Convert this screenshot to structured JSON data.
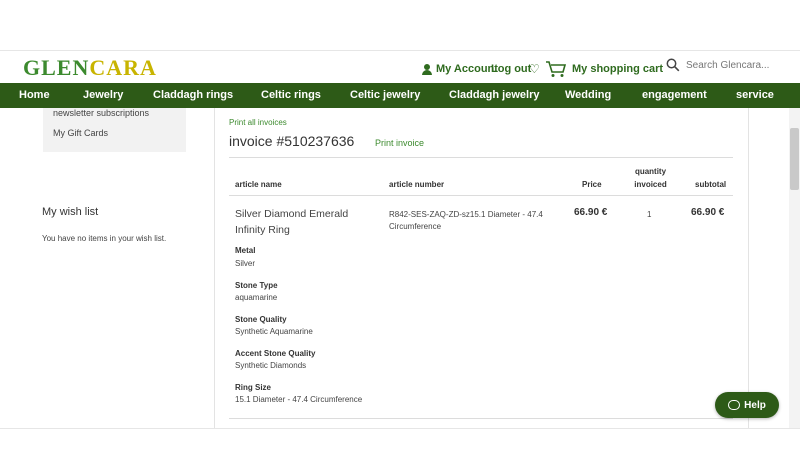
{
  "brand": {
    "logo_part1": "GLEN",
    "logo_part2": "CARA",
    "colors": {
      "green": "#2d5a17",
      "gold": "#c8b400",
      "link_green": "#3c8a2e"
    }
  },
  "header": {
    "account_label": "My Account",
    "logout_label": "Log out",
    "cart_label": "My shopping cart",
    "search_placeholder": "Search Glencara..."
  },
  "nav": {
    "items": [
      "Home",
      "Jewelry",
      "Claddagh rings",
      "Celtic rings",
      "Celtic jewelry",
      "Claddagh jewelry",
      "Wedding",
      "engagement",
      "service"
    ]
  },
  "sidebar": {
    "links": [
      "newsletter subscriptions",
      "My Gift Cards"
    ],
    "wishlist_title": "My wish list",
    "wishlist_empty": "You have no items in your wish list."
  },
  "invoice": {
    "print_all": "Print all invoices",
    "title": "invoice #510237636",
    "print_invoice": "Print invoice",
    "columns": {
      "article_name": "article name",
      "article_number": "article number",
      "price": "Price",
      "qty_line1": "quantity",
      "qty_line2": "invoiced",
      "subtotal": "subtotal"
    },
    "item": {
      "name": "Silver Diamond Emerald Infinity Ring",
      "article_number": "R842-SES-ZAQ-ZD-sz15.1 Diameter - 47.4 Circumference",
      "price": "66.90 €",
      "quantity": "1",
      "subtotal": "66.90 €",
      "options": [
        {
          "label": "Metal",
          "value": "Silver"
        },
        {
          "label": "Stone Type",
          "value": "aquamarine"
        },
        {
          "label": "Stone Quality",
          "value": "Synthetic Aquamarine"
        },
        {
          "label": "Accent Stone Quality",
          "value": "Synthetic Diamonds"
        },
        {
          "label": "Ring Size",
          "value": "15.1 Diameter - 47.4 Circumference"
        }
      ]
    }
  },
  "help": {
    "label": "Help"
  }
}
